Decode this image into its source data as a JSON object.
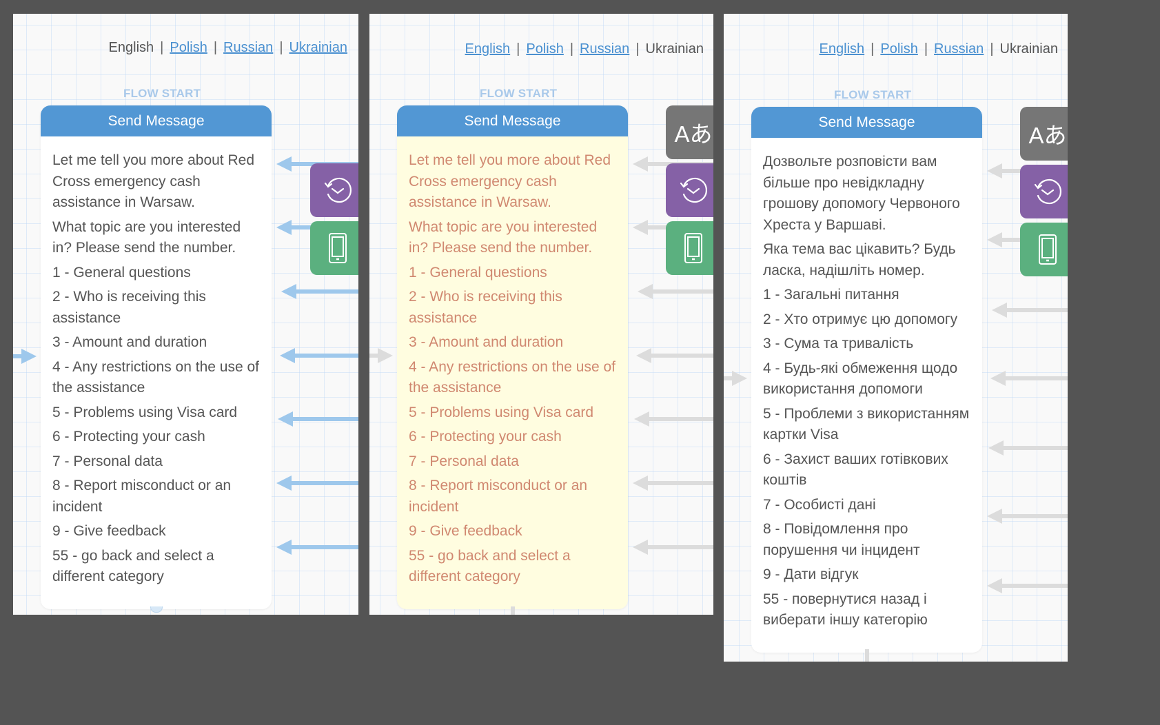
{
  "panels": [
    {
      "languages": [
        {
          "label": "English",
          "active": true
        },
        {
          "label": "Polish",
          "active": false
        },
        {
          "label": "Russian",
          "active": false
        },
        {
          "label": "Ukrainian",
          "active": false
        }
      ],
      "flow_start": "FLOW START",
      "node_title": "Send Message",
      "paragraphs": [
        "Let me tell you more about Red Cross emergency cash assistance in Warsaw.",
        "What topic are you interested in? Please send the number.",
        "1 - General questions",
        "2 - Who is receiving this assistance",
        "3 - Amount and duration",
        "4 - Any restrictions on the use of the assistance",
        "5 - Problems using Visa card",
        "6 - Protecting your cash",
        "7 - Personal data",
        "8 - Report misconduct or an incident",
        "9 - Give feedback",
        "55 - go back and select a different category"
      ]
    },
    {
      "languages": [
        {
          "label": "English",
          "active": false
        },
        {
          "label": "Polish",
          "active": false
        },
        {
          "label": "Russian",
          "active": false
        },
        {
          "label": "Ukrainian",
          "active": true
        }
      ],
      "flow_start": "FLOW START",
      "node_title": "Send Message",
      "paragraphs": [
        "Let me tell you more about Red Cross emergency cash assistance in Warsaw.",
        "What topic are you interested in? Please send the number.",
        "1 - General questions",
        "2 - Who is receiving this assistance",
        "3 - Amount and duration",
        "4 - Any restrictions on the use of the assistance",
        "5 - Problems using Visa card",
        "6 - Protecting your cash",
        "7 - Personal data",
        "8 - Report misconduct or an incident",
        "9 - Give feedback",
        "55 - go back and select a different category"
      ]
    },
    {
      "languages": [
        {
          "label": "English",
          "active": false
        },
        {
          "label": "Polish",
          "active": false
        },
        {
          "label": "Russian",
          "active": false
        },
        {
          "label": "Ukrainian",
          "active": true
        }
      ],
      "flow_start": "FLOW START",
      "node_title": "Send Message",
      "paragraphs": [
        "Дозвольте розповісти вам більше про невідкладну грошову допомогу Червоного Хреста у Варшаві.",
        "Яка тема вас цікавить? Будь ласка, надішліть номер.",
        "1 - Загальні питання",
        "2 - Хто отримує цю допомогу",
        "3 - Сума та тривалість",
        "4 - Будь-які обмеження щодо використання допомоги",
        "5 - Проблеми з використанням картки Visa",
        "6 - Захист ваших готівкових коштів",
        "7 - Особисті дані",
        "8 - Повідомлення про порушення чи інцидент",
        "9 - Дати відгук",
        "55 - повернутися назад і виберати іншу категорію"
      ]
    }
  ],
  "icons": {
    "translate": "Aあ",
    "separator": "|"
  },
  "colors": {
    "node_header": "#5297d4",
    "link": "#4a90d0",
    "wait_action": "#8561a6",
    "phone_action": "#5bb07f",
    "translate_action": "#767676",
    "untranslated_text": "#d08870",
    "untranslated_bg": "#fffde0"
  }
}
